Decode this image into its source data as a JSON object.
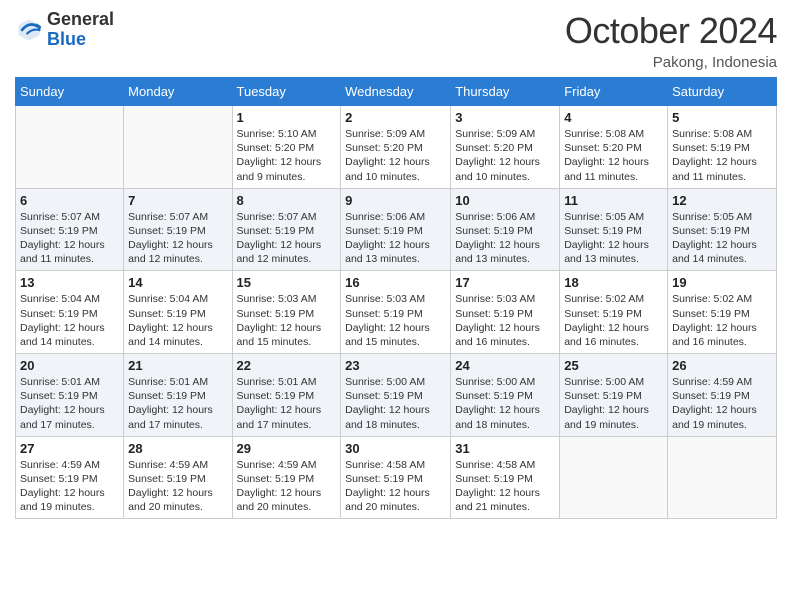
{
  "header": {
    "logo_general": "General",
    "logo_blue": "Blue",
    "month_title": "October 2024",
    "location": "Pakong, Indonesia"
  },
  "weekdays": [
    "Sunday",
    "Monday",
    "Tuesday",
    "Wednesday",
    "Thursday",
    "Friday",
    "Saturday"
  ],
  "weeks": [
    [
      {
        "day": "",
        "sunrise": "",
        "sunset": "",
        "daylight": ""
      },
      {
        "day": "",
        "sunrise": "",
        "sunset": "",
        "daylight": ""
      },
      {
        "day": "1",
        "sunrise": "Sunrise: 5:10 AM",
        "sunset": "Sunset: 5:20 PM",
        "daylight": "Daylight: 12 hours and 9 minutes."
      },
      {
        "day": "2",
        "sunrise": "Sunrise: 5:09 AM",
        "sunset": "Sunset: 5:20 PM",
        "daylight": "Daylight: 12 hours and 10 minutes."
      },
      {
        "day": "3",
        "sunrise": "Sunrise: 5:09 AM",
        "sunset": "Sunset: 5:20 PM",
        "daylight": "Daylight: 12 hours and 10 minutes."
      },
      {
        "day": "4",
        "sunrise": "Sunrise: 5:08 AM",
        "sunset": "Sunset: 5:20 PM",
        "daylight": "Daylight: 12 hours and 11 minutes."
      },
      {
        "day": "5",
        "sunrise": "Sunrise: 5:08 AM",
        "sunset": "Sunset: 5:19 PM",
        "daylight": "Daylight: 12 hours and 11 minutes."
      }
    ],
    [
      {
        "day": "6",
        "sunrise": "Sunrise: 5:07 AM",
        "sunset": "Sunset: 5:19 PM",
        "daylight": "Daylight: 12 hours and 11 minutes."
      },
      {
        "day": "7",
        "sunrise": "Sunrise: 5:07 AM",
        "sunset": "Sunset: 5:19 PM",
        "daylight": "Daylight: 12 hours and 12 minutes."
      },
      {
        "day": "8",
        "sunrise": "Sunrise: 5:07 AM",
        "sunset": "Sunset: 5:19 PM",
        "daylight": "Daylight: 12 hours and 12 minutes."
      },
      {
        "day": "9",
        "sunrise": "Sunrise: 5:06 AM",
        "sunset": "Sunset: 5:19 PM",
        "daylight": "Daylight: 12 hours and 13 minutes."
      },
      {
        "day": "10",
        "sunrise": "Sunrise: 5:06 AM",
        "sunset": "Sunset: 5:19 PM",
        "daylight": "Daylight: 12 hours and 13 minutes."
      },
      {
        "day": "11",
        "sunrise": "Sunrise: 5:05 AM",
        "sunset": "Sunset: 5:19 PM",
        "daylight": "Daylight: 12 hours and 13 minutes."
      },
      {
        "day": "12",
        "sunrise": "Sunrise: 5:05 AM",
        "sunset": "Sunset: 5:19 PM",
        "daylight": "Daylight: 12 hours and 14 minutes."
      }
    ],
    [
      {
        "day": "13",
        "sunrise": "Sunrise: 5:04 AM",
        "sunset": "Sunset: 5:19 PM",
        "daylight": "Daylight: 12 hours and 14 minutes."
      },
      {
        "day": "14",
        "sunrise": "Sunrise: 5:04 AM",
        "sunset": "Sunset: 5:19 PM",
        "daylight": "Daylight: 12 hours and 14 minutes."
      },
      {
        "day": "15",
        "sunrise": "Sunrise: 5:03 AM",
        "sunset": "Sunset: 5:19 PM",
        "daylight": "Daylight: 12 hours and 15 minutes."
      },
      {
        "day": "16",
        "sunrise": "Sunrise: 5:03 AM",
        "sunset": "Sunset: 5:19 PM",
        "daylight": "Daylight: 12 hours and 15 minutes."
      },
      {
        "day": "17",
        "sunrise": "Sunrise: 5:03 AM",
        "sunset": "Sunset: 5:19 PM",
        "daylight": "Daylight: 12 hours and 16 minutes."
      },
      {
        "day": "18",
        "sunrise": "Sunrise: 5:02 AM",
        "sunset": "Sunset: 5:19 PM",
        "daylight": "Daylight: 12 hours and 16 minutes."
      },
      {
        "day": "19",
        "sunrise": "Sunrise: 5:02 AM",
        "sunset": "Sunset: 5:19 PM",
        "daylight": "Daylight: 12 hours and 16 minutes."
      }
    ],
    [
      {
        "day": "20",
        "sunrise": "Sunrise: 5:01 AM",
        "sunset": "Sunset: 5:19 PM",
        "daylight": "Daylight: 12 hours and 17 minutes."
      },
      {
        "day": "21",
        "sunrise": "Sunrise: 5:01 AM",
        "sunset": "Sunset: 5:19 PM",
        "daylight": "Daylight: 12 hours and 17 minutes."
      },
      {
        "day": "22",
        "sunrise": "Sunrise: 5:01 AM",
        "sunset": "Sunset: 5:19 PM",
        "daylight": "Daylight: 12 hours and 17 minutes."
      },
      {
        "day": "23",
        "sunrise": "Sunrise: 5:00 AM",
        "sunset": "Sunset: 5:19 PM",
        "daylight": "Daylight: 12 hours and 18 minutes."
      },
      {
        "day": "24",
        "sunrise": "Sunrise: 5:00 AM",
        "sunset": "Sunset: 5:19 PM",
        "daylight": "Daylight: 12 hours and 18 minutes."
      },
      {
        "day": "25",
        "sunrise": "Sunrise: 5:00 AM",
        "sunset": "Sunset: 5:19 PM",
        "daylight": "Daylight: 12 hours and 19 minutes."
      },
      {
        "day": "26",
        "sunrise": "Sunrise: 4:59 AM",
        "sunset": "Sunset: 5:19 PM",
        "daylight": "Daylight: 12 hours and 19 minutes."
      }
    ],
    [
      {
        "day": "27",
        "sunrise": "Sunrise: 4:59 AM",
        "sunset": "Sunset: 5:19 PM",
        "daylight": "Daylight: 12 hours and 19 minutes."
      },
      {
        "day": "28",
        "sunrise": "Sunrise: 4:59 AM",
        "sunset": "Sunset: 5:19 PM",
        "daylight": "Daylight: 12 hours and 20 minutes."
      },
      {
        "day": "29",
        "sunrise": "Sunrise: 4:59 AM",
        "sunset": "Sunset: 5:19 PM",
        "daylight": "Daylight: 12 hours and 20 minutes."
      },
      {
        "day": "30",
        "sunrise": "Sunrise: 4:58 AM",
        "sunset": "Sunset: 5:19 PM",
        "daylight": "Daylight: 12 hours and 20 minutes."
      },
      {
        "day": "31",
        "sunrise": "Sunrise: 4:58 AM",
        "sunset": "Sunset: 5:19 PM",
        "daylight": "Daylight: 12 hours and 21 minutes."
      },
      {
        "day": "",
        "sunrise": "",
        "sunset": "",
        "daylight": ""
      },
      {
        "day": "",
        "sunrise": "",
        "sunset": "",
        "daylight": ""
      }
    ]
  ]
}
